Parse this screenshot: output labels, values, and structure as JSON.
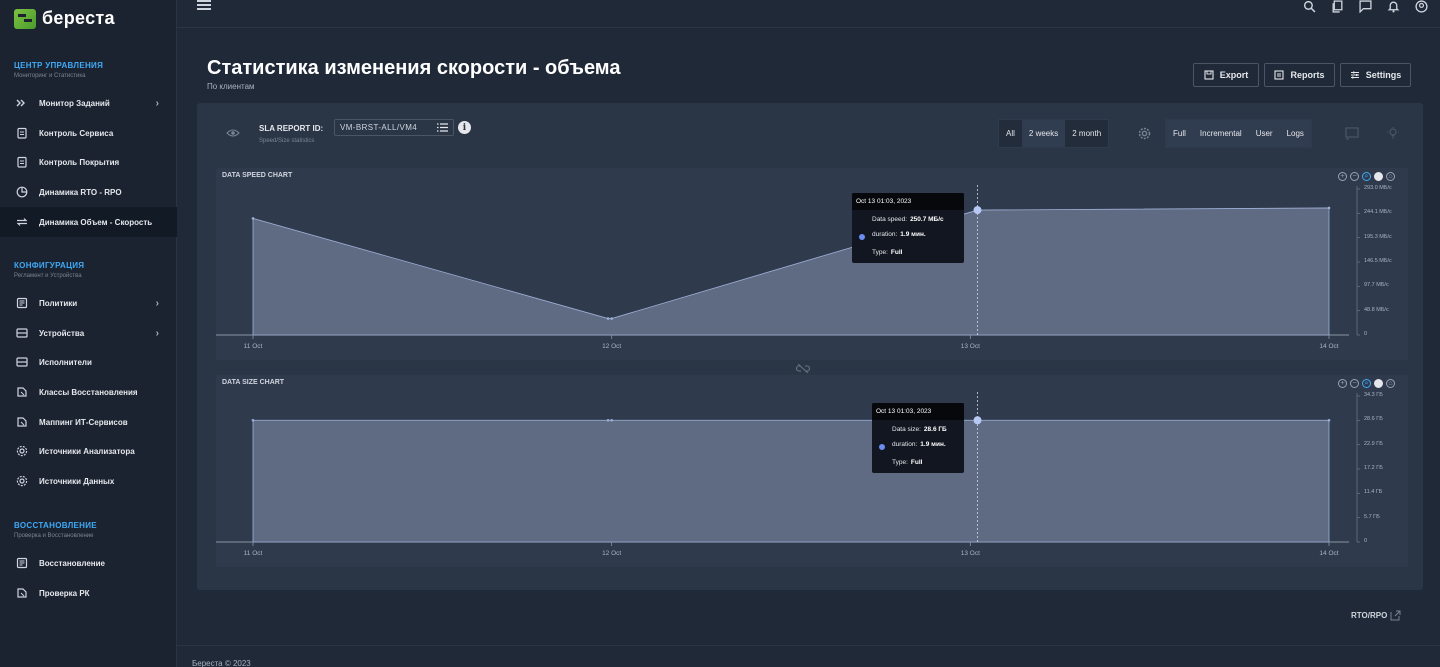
{
  "app": {
    "logo_text": "береста"
  },
  "sidebar": {
    "sections": [
      {
        "title": "ЦЕНТР УПРАВЛЕНИЯ",
        "subtitle": "Мониторинг и Статистика"
      },
      {
        "title": "КОНФИГУРАЦИЯ",
        "subtitle": "Регламент и Устройства"
      },
      {
        "title": "ВОССТАНОВЛЕНИЕ",
        "subtitle": "Проверка и Восстановление"
      }
    ],
    "items": [
      {
        "label": "Монитор Заданий",
        "icon": "double-chevron-icon"
      },
      {
        "label": "Контроль Сервиса",
        "icon": "clipboard-icon"
      },
      {
        "label": "Контроль Покрытия",
        "icon": "clipboard-icon"
      },
      {
        "label": "Динамика RTO - RPO",
        "icon": "pie-chart-icon"
      },
      {
        "label": "Динамика Объем - Скорость",
        "icon": "transfer-icon"
      },
      {
        "label": "Политики",
        "icon": "policy-icon"
      },
      {
        "label": "Устройства",
        "icon": "server-icon"
      },
      {
        "label": "Исполнители",
        "icon": "server-icon"
      },
      {
        "label": "Классы Восстановления",
        "icon": "stack-icon"
      },
      {
        "label": "Маппинг ИТ-Сервисов",
        "icon": "stack-icon"
      },
      {
        "label": "Источники Анализатора",
        "icon": "gear-icon"
      },
      {
        "label": "Источники Данных",
        "icon": "gear-icon"
      },
      {
        "label": "Восстановление",
        "icon": "policy-icon"
      },
      {
        "label": "Проверка РК",
        "icon": "stack-icon"
      }
    ]
  },
  "header": {
    "title": "Статистика изменения скорости - объема",
    "subtitle": "По клиентам",
    "buttons": {
      "export": "Export",
      "reports": "Reports",
      "settings": "Settings"
    }
  },
  "filters": {
    "sla_label": "SLA REPORT ID:",
    "sla_sub": "Speed/Size statistics",
    "sla_value": "VM-BRST-ALL/VM4",
    "info_glyph": "i",
    "periods": [
      "All",
      "2 weeks",
      "2 month"
    ],
    "selected_period": "2 weeks",
    "types": [
      "Full",
      "Incremental",
      "User",
      "Logs"
    ]
  },
  "chart_data": [
    {
      "type": "area",
      "title": "DATA SPEED CHART",
      "x": [
        "11 Oct",
        "12 Oct",
        "12 Oct",
        "13 Oct",
        "14 Oct"
      ],
      "x_positions": [
        0,
        0.99,
        1.0,
        2.02,
        3.0
      ],
      "values": [
        234,
        33,
        33,
        250.7,
        255
      ],
      "y_unit": "МБ/с",
      "yticks": [
        "0",
        "48.8 МБ/с",
        "97.7 МБ/с",
        "146.5 МБ/с",
        "195.3 МБ/с",
        "244.1 МБ/с",
        "293.0 МБ/с"
      ],
      "ylim": [
        0,
        293.0
      ],
      "xticks": [
        "11 Oct",
        "12 Oct",
        "13 Oct",
        "14 Oct"
      ],
      "tooltip": {
        "header": "Oct 13 01:03, 2023",
        "rows": [
          {
            "label": "Data speed:",
            "value": "250.7 МБ/с"
          },
          {
            "label": "duration:",
            "value": "1.9 мин."
          },
          {
            "label": "Type:",
            "value": "Full"
          }
        ]
      },
      "highlight_index": 3,
      "color": "#5f6b83"
    },
    {
      "type": "area",
      "title": "DATA SIZE CHART",
      "x": [
        "11 Oct",
        "12 Oct",
        "12 Oct",
        "13 Oct",
        "14 Oct"
      ],
      "x_positions": [
        0,
        0.99,
        1.0,
        2.02,
        3.0
      ],
      "values": [
        28.6,
        28.6,
        28.6,
        28.6,
        28.6
      ],
      "y_unit": "ГБ",
      "yticks": [
        "0",
        "5.7 ГБ",
        "11.4 ГБ",
        "17.2 ГБ",
        "22.9 ГБ",
        "28.6 ГБ",
        "34.3 ГБ"
      ],
      "ylim": [
        0,
        34.3
      ],
      "xticks": [
        "11 Oct",
        "12 Oct",
        "13 Oct",
        "14 Oct"
      ],
      "tooltip": {
        "header": "Oct 13 01:03, 2023",
        "rows": [
          {
            "label": "Data size:",
            "value": "28.6 ГБ"
          },
          {
            "label": "duration:",
            "value": "1.9 мин."
          },
          {
            "label": "Type:",
            "value": "Full"
          }
        ]
      },
      "highlight_index": 3,
      "color": "#5f6b83"
    }
  ],
  "links": {
    "rto_rpo": "RTO/RPO"
  },
  "footer": {
    "text": "Береста © 2023"
  }
}
